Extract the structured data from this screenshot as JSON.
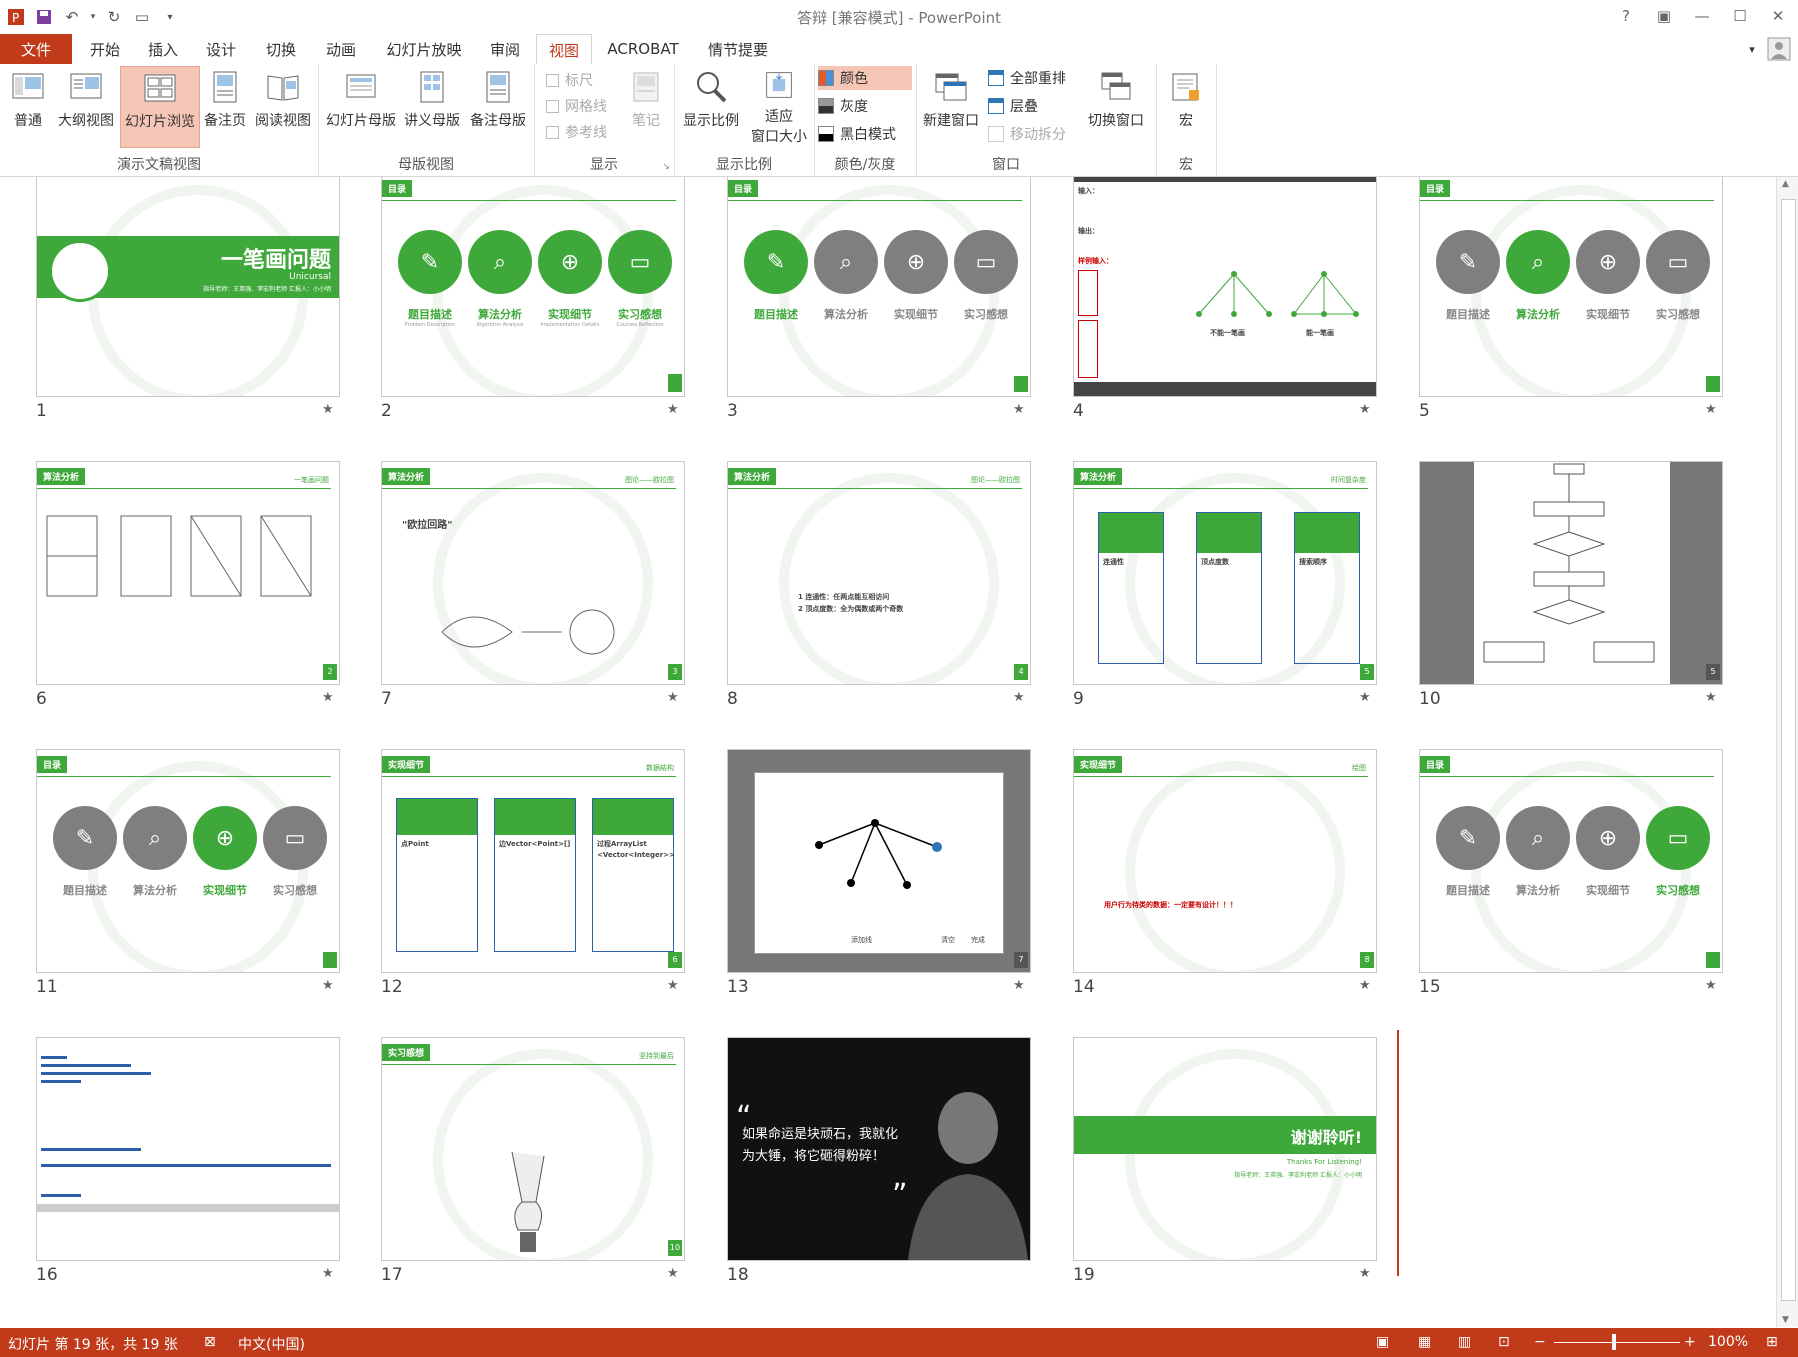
{
  "app": {
    "title": "答辩 [兼容模式] - PowerPoint"
  },
  "qat": {
    "save": "save-icon",
    "undo": "undo-icon",
    "redo": "redo-icon",
    "present": "present-icon"
  },
  "window": {
    "help": "?",
    "restore": "restore-icon",
    "minimize": "minimize-icon",
    "maximize": "maximize-icon",
    "close": "close-icon"
  },
  "tabs": {
    "file": "文件",
    "items": [
      "开始",
      "插入",
      "设计",
      "切换",
      "动画",
      "幻灯片放映",
      "审阅",
      "视图",
      "ACROBAT",
      "情节提要"
    ],
    "active": "视图"
  },
  "ribbon": {
    "presentation_views": {
      "label": "演示文稿视图",
      "normal": "普通",
      "outline": "大纲视图",
      "sorter": "幻灯片浏览",
      "notes": "备注页",
      "reading": "阅读视图"
    },
    "master_views": {
      "label": "母版视图",
      "slide_master": "幻灯片母版",
      "handout_master": "讲义母版",
      "notes_master": "备注母版"
    },
    "show": {
      "label": "显示",
      "ruler": "标尺",
      "gridlines": "网格线",
      "guides": "参考线",
      "notes": "笔记"
    },
    "zoom": {
      "label": "显示比例",
      "zoom": "显示比例",
      "fit_line1": "适应",
      "fit_line2": "窗口大小"
    },
    "color": {
      "label": "颜色/灰度",
      "color": "颜色",
      "grayscale": "灰度",
      "bw": "黑白模式"
    },
    "window": {
      "label": "窗口",
      "new_window": "新建窗口",
      "arrange_all": "全部重排",
      "cascade": "层叠",
      "move_split": "移动拆分",
      "switch_windows": "切换窗口"
    },
    "macros": {
      "label": "宏",
      "macros": "宏"
    }
  },
  "slides": [
    {
      "n": "1"
    },
    {
      "n": "2"
    },
    {
      "n": "3"
    },
    {
      "n": "4"
    },
    {
      "n": "5"
    },
    {
      "n": "6"
    },
    {
      "n": "7"
    },
    {
      "n": "8"
    },
    {
      "n": "9"
    },
    {
      "n": "10"
    },
    {
      "n": "11"
    },
    {
      "n": "12"
    },
    {
      "n": "13"
    },
    {
      "n": "14"
    },
    {
      "n": "15"
    },
    {
      "n": "16"
    },
    {
      "n": "17"
    },
    {
      "n": "18"
    },
    {
      "n": "19"
    }
  ],
  "slide_text": {
    "s1_title": "一笔画问题",
    "s1_sub": "Unicursal",
    "s1_credit": "指导老师：王英强、李宏利老师   汇报人：小小明",
    "toc_tag": "目录",
    "toc": [
      {
        "cn": "题目描述",
        "en": "Problem Description"
      },
      {
        "cn": "算法分析",
        "en": "Algorithm Analysis"
      },
      {
        "cn": "实现细节",
        "en": "Implementation Details"
      },
      {
        "cn": "实习感想",
        "en": "Coursea Reflection"
      }
    ],
    "s4_in": "输入：",
    "s4_out": "输出：",
    "s4_sample": "样例输入：",
    "s4_a": "不能一笔画",
    "s4_b": "能一笔画",
    "alg_tag": "算法分析",
    "s6_right": "一笔画问题",
    "s7_right": "图论——欧拉图",
    "s7_bold": "\"欧拉回路\"",
    "s8_right": "图论——欧拉图",
    "s8_p1": "1  连通性：任两点能互相访问",
    "s8_p2": "2  顶点度数：全为偶数或两个奇数",
    "s9_right": "时间复杂度",
    "s9_cards": [
      "连通性",
      "顶点度数",
      "搜索顺序"
    ],
    "impl_tag": "实现细节",
    "s12_right": "数据结构",
    "s12_cards": [
      "点Point",
      "边Vector<Point>[]",
      "过程ArrayList <Vector<Integer>>"
    ],
    "s13_btn": "添加线",
    "s13_b1": "清空",
    "s13_b2": "完成",
    "s14_right": "绘图",
    "s14_bold": "用户行为待类的数据：一定要有设计！！！",
    "s17_tag": "实习感想",
    "s17_right": "坚持到最后",
    "s18_quote": "如果命运是块顽石，我就化为大锤，将它砸得粉碎！",
    "s19_title": "谢谢聆听!",
    "s19_sub": "Thanks For Listening!",
    "s19_credit": "指导老师：王英强、李宏利老师   汇报人：小小明"
  },
  "status": {
    "slide_info": "幻灯片 第 19 张，共 19 张",
    "lang": "中文(中国)",
    "zoom": "100%"
  },
  "colors": {
    "accent": "#c13b1b",
    "green": "#3fa83a",
    "gray": "#7f7f7f"
  }
}
